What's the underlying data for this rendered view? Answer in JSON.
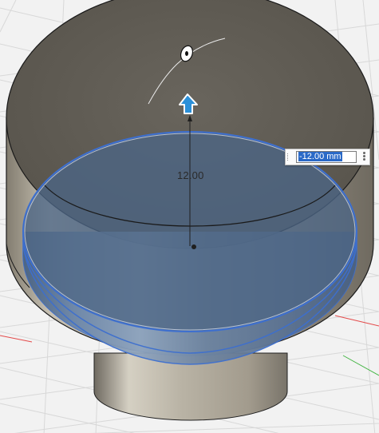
{
  "viewport": {
    "view": "3d-perspective",
    "grid": true
  },
  "dimension": {
    "label": "12.00",
    "input_value": "-12.00 mm"
  },
  "icons": {
    "drag_arrow": "up-arrow-icon",
    "input_menu": "more-vertical-icon",
    "sketch_point": "sketch-point-icon"
  },
  "colors": {
    "selected_face_edge": "#3d6fcf",
    "selected_fill": "#5f7a9c",
    "arrow_fill": "#2b90d9",
    "body_dark": "#5f5b52",
    "body_light": "#b8b3a6"
  }
}
